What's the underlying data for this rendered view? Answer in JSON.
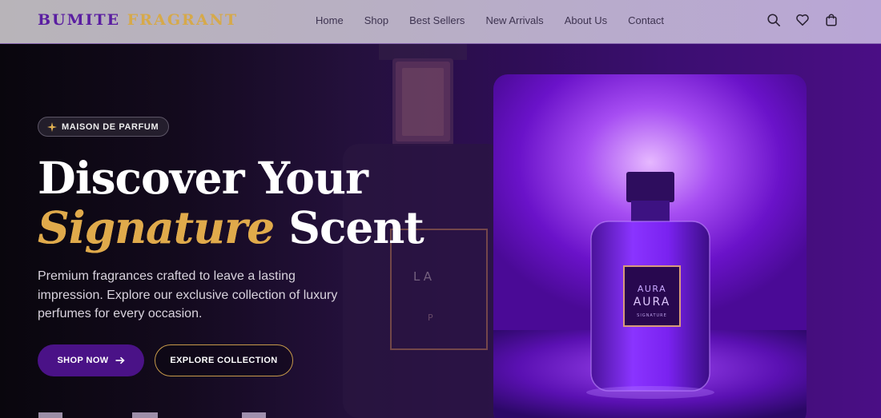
{
  "brand": {
    "part1": "BUMITE",
    "part2": "FRAGRANT",
    "accent": "#5a1ea1",
    "gold": "#d6a94a"
  },
  "nav": {
    "links": [
      "Home",
      "Shop",
      "Best Sellers",
      "New Arrivals",
      "About Us",
      "Contact"
    ],
    "icons": [
      "search-icon",
      "heart-icon",
      "shopping-bag-icon"
    ]
  },
  "hero": {
    "badge": "MAISON DE PARFUM",
    "headline_line1": "Discover Your",
    "headline_highlight": "Signature",
    "headline_rest": "Scent",
    "description": "Premium fragrances crafted to leave a lasting impression. Explore our exclusive collection of luxury perfumes for every occasion.",
    "primary_cta": "SHOP NOW",
    "secondary_cta": "EXPLORE COLLECTION",
    "product_label": {
      "line1": "AURA",
      "line2": "AURA",
      "line3": "SIGNATURE"
    },
    "background_bottle_label": {
      "line1": "LA",
      "line2": "P"
    }
  },
  "colors": {
    "primary": "#4a1287",
    "gold": "#c79a4a",
    "hero_glow": "#a64df2"
  }
}
